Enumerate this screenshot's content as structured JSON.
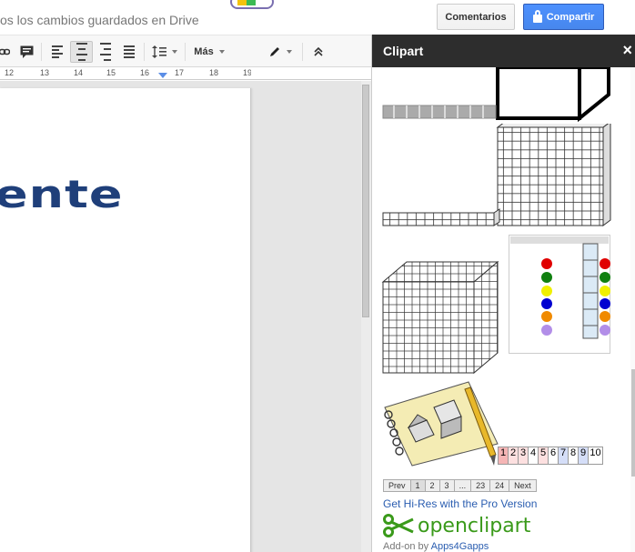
{
  "topbar": {
    "save_status": "os los cambios guardados en Drive",
    "comments_label": "Comentarios",
    "share_label": "Compartir"
  },
  "toolbar": {
    "more_label": "Más"
  },
  "ruler": {
    "numbers": [
      "12",
      "13",
      "14",
      "15",
      "16",
      "17",
      "18",
      "19"
    ]
  },
  "document": {
    "visible_text": "ente"
  },
  "sidebar": {
    "title": "Clipart",
    "close_glyph": "×",
    "pager": [
      "Prev",
      "1",
      "2",
      "3",
      "...",
      "23",
      "24",
      "Next"
    ],
    "pager_current": "1",
    "number_strip": [
      "1",
      "2",
      "3",
      "4",
      "5",
      "6",
      "7",
      "8",
      "9",
      "10"
    ],
    "get_hires_label": "Get Hi-Res with the Pro Version",
    "openclipart_label": "openclipart",
    "addon_prefix": "Add-on by",
    "addon_link": "Apps4Gapps"
  },
  "icons": {
    "link": "link-icon",
    "comment": "comment-icon",
    "align_left": "align-left-icon",
    "align_center": "align-center-icon",
    "align_right": "align-right-icon",
    "justify": "justify-icon",
    "line_spacing": "line-spacing-icon",
    "pencil": "pencil-icon",
    "collapse": "chevron-up-icon",
    "lock": "lock-icon",
    "scissors": "scissors-icon"
  },
  "colors": {
    "share_blue": "#4d90fe",
    "sidebar_header": "#2d2d2d",
    "link_blue": "#2a5db0",
    "doc_text_blue": "#1f3f7a",
    "openclipart_green": "#3a9a1a"
  }
}
